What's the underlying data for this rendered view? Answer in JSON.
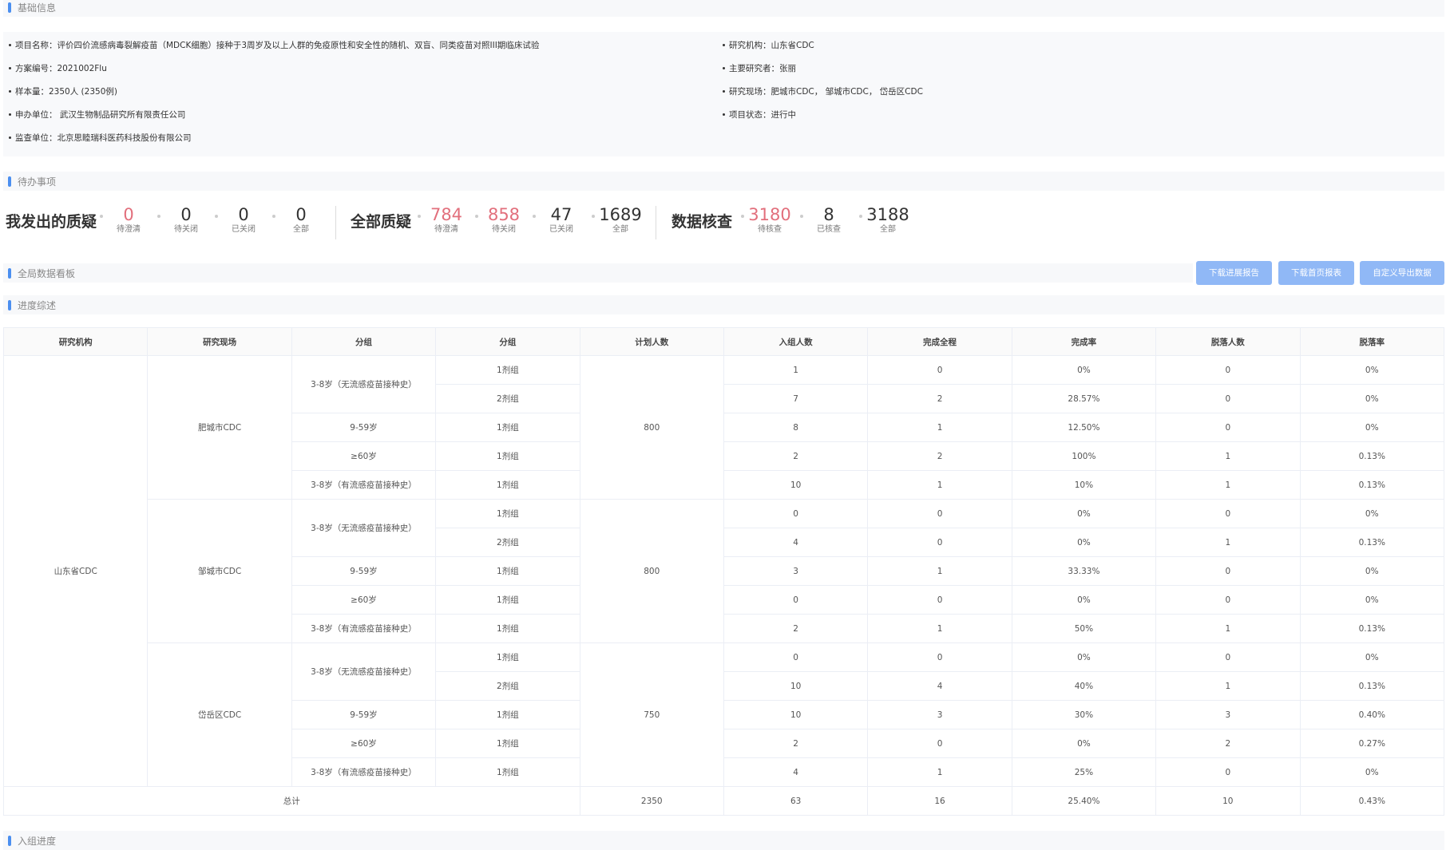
{
  "sections": {
    "basic": "基础信息",
    "todo": "待办事项",
    "dashboard": "全局数据看板",
    "progress": "进度综述",
    "enroll": "入组进度"
  },
  "info_left": [
    "项目名称：评价四价流感病毒裂解疫苗（MDCK细胞）接种于3周岁及以上人群的免疫原性和安全性的随机、双盲、同类疫苗对照III期临床试验",
    "方案编号：2021002Flu",
    "样本量：2350人 (2350例)",
    "申办单位： 武汉生物制品研究所有限责任公司",
    "监查单位：北京思睦瑞科医药科技股份有限公司"
  ],
  "info_right": [
    "研究机构：山东省CDC",
    "主要研究者：张丽",
    "研究现场：肥城市CDC， 邹城市CDC， 岱岳区CDC",
    "项目状态：进行中"
  ],
  "todo": {
    "my_title": "我发出的质疑",
    "my": [
      {
        "num": "0",
        "label": "待澄清",
        "color": "#e26f7c"
      },
      {
        "num": "0",
        "label": "待关闭",
        "color": "#333333"
      },
      {
        "num": "0",
        "label": "已关闭",
        "color": "#333333"
      },
      {
        "num": "0",
        "label": "全部",
        "color": "#333333"
      }
    ],
    "all_title": "全部质疑",
    "all": [
      {
        "num": "784",
        "label": "待澄清",
        "color": "#e26f7c"
      },
      {
        "num": "858",
        "label": "待关闭",
        "color": "#e26f7c"
      },
      {
        "num": "47",
        "label": "已关闭",
        "color": "#333333"
      },
      {
        "num": "1689",
        "label": "全部",
        "color": "#333333"
      }
    ],
    "check_title": "数据核查",
    "check": [
      {
        "num": "3180",
        "label": "待核查",
        "color": "#e26f7c"
      },
      {
        "num": "8",
        "label": "已核查",
        "color": "#333333"
      },
      {
        "num": "3188",
        "label": "全部",
        "color": "#333333"
      }
    ]
  },
  "buttons": {
    "download_progress": "下载进展报告",
    "download_homepage": "下载首页报表",
    "custom_export": "自定义导出数据"
  },
  "table": {
    "headers": [
      "研究机构",
      "研究现场",
      "分组",
      "分组",
      "计划人数",
      "入组人数",
      "完成全程",
      "完成率",
      "脱落人数",
      "脱落率"
    ],
    "institution": "山东省CDC",
    "sites": [
      {
        "name": "肥城市CDC",
        "plan": "800",
        "groups": [
          {
            "name": "3-8岁（无流感疫苗接种史）",
            "rows": [
              {
                "dose": "1剂组",
                "enrolled": "1",
                "completed": "0",
                "rate": "0%",
                "drop": "0",
                "drop_rate": "0%"
              },
              {
                "dose": "2剂组",
                "enrolled": "7",
                "completed": "2",
                "rate": "28.57%",
                "drop": "0",
                "drop_rate": "0%"
              }
            ]
          },
          {
            "name": "9-59岁",
            "rows": [
              {
                "dose": "1剂组",
                "enrolled": "8",
                "completed": "1",
                "rate": "12.50%",
                "drop": "0",
                "drop_rate": "0%"
              }
            ]
          },
          {
            "name": "≥60岁",
            "rows": [
              {
                "dose": "1剂组",
                "enrolled": "2",
                "completed": "2",
                "rate": "100%",
                "drop": "1",
                "drop_rate": "0.13%"
              }
            ]
          },
          {
            "name": "3-8岁（有流感疫苗接种史）",
            "rows": [
              {
                "dose": "1剂组",
                "enrolled": "10",
                "completed": "1",
                "rate": "10%",
                "drop": "1",
                "drop_rate": "0.13%"
              }
            ]
          }
        ]
      },
      {
        "name": "邹城市CDC",
        "plan": "800",
        "groups": [
          {
            "name": "3-8岁（无流感疫苗接种史）",
            "rows": [
              {
                "dose": "1剂组",
                "enrolled": "0",
                "completed": "0",
                "rate": "0%",
                "drop": "0",
                "drop_rate": "0%"
              },
              {
                "dose": "2剂组",
                "enrolled": "4",
                "completed": "0",
                "rate": "0%",
                "drop": "1",
                "drop_rate": "0.13%"
              }
            ]
          },
          {
            "name": "9-59岁",
            "rows": [
              {
                "dose": "1剂组",
                "enrolled": "3",
                "completed": "1",
                "rate": "33.33%",
                "drop": "0",
                "drop_rate": "0%"
              }
            ]
          },
          {
            "name": "≥60岁",
            "rows": [
              {
                "dose": "1剂组",
                "enrolled": "0",
                "completed": "0",
                "rate": "0%",
                "drop": "0",
                "drop_rate": "0%"
              }
            ]
          },
          {
            "name": "3-8岁（有流感疫苗接种史）",
            "rows": [
              {
                "dose": "1剂组",
                "enrolled": "2",
                "completed": "1",
                "rate": "50%",
                "drop": "1",
                "drop_rate": "0.13%"
              }
            ]
          }
        ]
      },
      {
        "name": "岱岳区CDC",
        "plan": "750",
        "groups": [
          {
            "name": "3-8岁（无流感疫苗接种史）",
            "rows": [
              {
                "dose": "1剂组",
                "enrolled": "0",
                "completed": "0",
                "rate": "0%",
                "drop": "0",
                "drop_rate": "0%"
              },
              {
                "dose": "2剂组",
                "enrolled": "10",
                "completed": "4",
                "rate": "40%",
                "drop": "1",
                "drop_rate": "0.13%"
              }
            ]
          },
          {
            "name": "9-59岁",
            "rows": [
              {
                "dose": "1剂组",
                "enrolled": "10",
                "completed": "3",
                "rate": "30%",
                "drop": "3",
                "drop_rate": "0.40%"
              }
            ]
          },
          {
            "name": "≥60岁",
            "rows": [
              {
                "dose": "1剂组",
                "enrolled": "2",
                "completed": "0",
                "rate": "0%",
                "drop": "2",
                "drop_rate": "0.27%"
              }
            ]
          },
          {
            "name": "3-8岁（有流感疫苗接种史）",
            "rows": [
              {
                "dose": "1剂组",
                "enrolled": "4",
                "completed": "1",
                "rate": "25%",
                "drop": "0",
                "drop_rate": "0%"
              }
            ]
          }
        ]
      }
    ],
    "total": {
      "label": "总计",
      "plan": "2350",
      "enrolled": "63",
      "completed": "16",
      "rate": "25.40%",
      "drop": "10",
      "drop_rate": "0.43%"
    }
  }
}
